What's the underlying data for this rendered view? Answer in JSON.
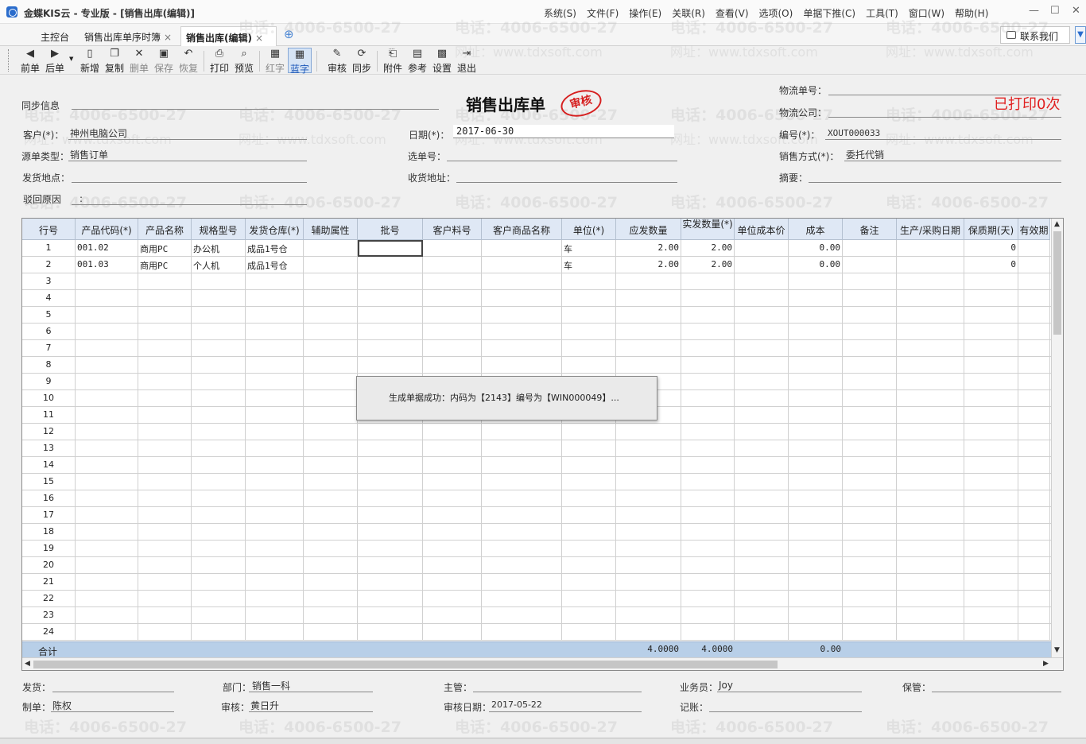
{
  "window": {
    "title": "金蝶KIS云 - 专业版 - [销售出库(编辑)]",
    "menu": [
      "系统(S)",
      "文件(F)",
      "操作(E)",
      "关联(R)",
      "查看(V)",
      "选项(O)",
      "单据下推(C)",
      "工具(T)",
      "窗口(W)",
      "帮助(H)"
    ],
    "min": "—",
    "max": "☐",
    "close": "✕"
  },
  "tabs": [
    {
      "label": "主控台"
    },
    {
      "label": "销售出库单序时簿"
    },
    {
      "label": "销售出库(编辑)"
    }
  ],
  "tab_add": "⊕",
  "contact": "联系我们",
  "side_arrow": "▼",
  "toolbar": [
    {
      "label": "前单",
      "icon": "◀"
    },
    {
      "label": "后单",
      "icon": "▶"
    },
    {
      "label": "新增",
      "icon": "▯"
    },
    {
      "label": "复制",
      "icon": "❐"
    },
    {
      "label": "删单",
      "icon": "✕"
    },
    {
      "label": "保存",
      "icon": "▣"
    },
    {
      "label": "恢复",
      "icon": "↶"
    },
    {
      "label": "打印",
      "icon": "⎙"
    },
    {
      "label": "预览",
      "icon": "⌕"
    },
    {
      "label": "红字",
      "icon": "▦"
    },
    {
      "label": "蓝字",
      "icon": "▦"
    },
    {
      "label": "审核",
      "icon": "✎"
    },
    {
      "label": "同步",
      "icon": "⟳"
    },
    {
      "label": "附件",
      "icon": "⎗"
    },
    {
      "label": "参考",
      "icon": "▤"
    },
    {
      "label": "设置",
      "icon": "▩"
    },
    {
      "label": "退出",
      "icon": "⇥"
    }
  ],
  "watermark": {
    "phone": "电话：4006-6500-27",
    "url": "网址：www.tdxsoft.com"
  },
  "form": {
    "title": "销售出库单",
    "stamp": "审核",
    "printed": "已打印0次",
    "sync_label": "同步信息",
    "customer_label": "客户(*)：",
    "customer": "神州电脑公司",
    "date_label": "日期(*)：",
    "date": "2017-06-30",
    "source_type_label": "源单类型：",
    "source_type": "销售订单",
    "select_no_label": "选单号：",
    "ship_place_label": "发货地点：",
    "recv_addr_label": "收货地址：",
    "reject_label": "驳回原因",
    "logistics_no_label": "物流单号：",
    "logistics_co_label": "物流公司：",
    "bill_no_label": "编号(*)：",
    "bill_no": "XOUT000033",
    "sale_mode_label": "销售方式(*)：",
    "sale_mode": "委托代销",
    "summary_label": "摘要："
  },
  "grid": {
    "headers": [
      "行号",
      "产品代码(*)",
      "产品名称",
      "规格型号",
      "发货仓库(*)",
      "辅助属性",
      "批号",
      "客户料号",
      "客户商品名称",
      "单位(*)",
      "应发数量",
      "实发数量(*)",
      "单位成本价",
      "成本",
      "备注",
      "生产/采购日期",
      "保质期(天)",
      "有效期"
    ],
    "rows": [
      [
        "1",
        "001.02",
        "商用PC",
        "办公机",
        "成品1号仓",
        "",
        "",
        "",
        "",
        "车",
        "2.00",
        "2.00",
        "",
        "0.00",
        "",
        "",
        "0",
        ""
      ],
      [
        "2",
        "001.03",
        "商用PC",
        "个人机",
        "成品1号仓",
        "",
        "",
        "",
        "",
        "车",
        "2.00",
        "2.00",
        "",
        "0.00",
        "",
        "",
        "0",
        ""
      ],
      [
        "3"
      ],
      [
        "4"
      ],
      [
        "5"
      ],
      [
        "6"
      ],
      [
        "7"
      ],
      [
        "8"
      ],
      [
        "9"
      ],
      [
        "10"
      ],
      [
        "11"
      ],
      [
        "12"
      ],
      [
        "13"
      ],
      [
        "14"
      ],
      [
        "15"
      ],
      [
        "16"
      ],
      [
        "17"
      ],
      [
        "18"
      ],
      [
        "19"
      ],
      [
        "20"
      ],
      [
        "21"
      ],
      [
        "22"
      ],
      [
        "23"
      ],
      [
        "24"
      ]
    ],
    "total_label": "合计",
    "total_due": "4.0000",
    "total_actual": "4.0000",
    "total_cost": "0.00"
  },
  "dialog": {
    "message": "生成单据成功：内码为【2143】编号为【WIN000049】..."
  },
  "footer": {
    "ship_label": "发货：",
    "dept_label": "部门：",
    "dept": "销售一科",
    "manager_label": "主管：",
    "salesman_label": "业务员：",
    "salesman": "Joy",
    "keeper_label": "保管：",
    "maker_label": "制单：",
    "maker": "陈权",
    "auditor_label": "审核：",
    "auditor": "黄日升",
    "audit_date_label": "审核日期：",
    "audit_date": "2017-05-22",
    "bookkeep_label": "记账："
  },
  "colors": {
    "stamp": "#d62020",
    "printed": "#e02020",
    "header_bg": "#dfe8f5",
    "total_bg": "#b8cfe8"
  }
}
